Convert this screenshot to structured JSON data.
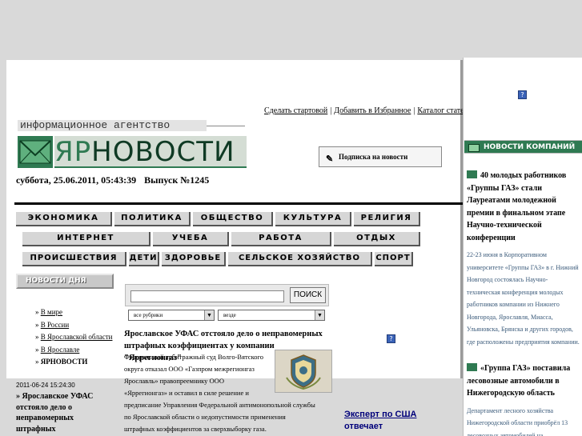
{
  "toplinks": {
    "make_start": "Сделать стартовой",
    "add_fav": "Добавить в Избранное",
    "catalog": "Каталог статей",
    "separator": "|"
  },
  "header": {
    "tagline": "информационное агентство",
    "logo_yar": "ЯР",
    "logo_novosti": "НОВОСТИ",
    "subscribe": "Подписка на новости",
    "date": "суббота, 25.06.2011, 05:43:39",
    "issue": "Выпуск №1245"
  },
  "nav": {
    "row1": [
      "ЭКОНОМИКА",
      "ПОЛИТИКА",
      "ОБЩЕСТВО",
      "КУЛЬТУРА",
      "РЕЛИГИЯ"
    ],
    "row2": [
      "ИНТЕРНЕТ",
      "УЧЕБА",
      "РАБОТА",
      "ОТДЫХ"
    ],
    "row3": [
      "ПРОИСШЕСТВИЯ",
      "ДЕТИ",
      "ЗДОРОВЬЕ",
      "СЕЛЬСКОЕ ХОЗЯЙСТВО",
      "СПОРТ"
    ]
  },
  "news_day": {
    "label": "НОВОСТИ ДНЯ",
    "links": [
      "В мире",
      "В России",
      "В Ярославской области",
      "В Ярославле",
      "ЯРНОВОСТИ"
    ],
    "item_date": "2011-06-24 15:24:30",
    "item_title": "» Ярославское УФАС отстояло дело о неправомерных штрафных"
  },
  "search": {
    "input_value": "",
    "button": "ПОИСК",
    "select_rubric": "все рубрики",
    "select_where": "везде"
  },
  "article": {
    "headline": "Ярославское УФАС отстояло дело о неправомерных штрафных коэффициентах у компании \"Яррегионгаз\"",
    "p1": "Федеральный арбитражный суд Волго-Вятского",
    "p2": "округа отказал ООО «Газпром межрегионгаз",
    "p3": "Ярославль» правопреемнику ООО",
    "p4": "«Яррегионгаз» и оставил в силе решение и",
    "p5": "предписание Управления Федеральной антимонопольной службы",
    "p6": "по Ярославской области о недопустимости применения",
    "p7": "штрафных коэффициентов за сверхвыборку газа."
  },
  "expert": {
    "line1": "Эксперт по США",
    "line2": "отвечает"
  },
  "company_news": {
    "header": "НОВОСТИ КОМПАНИЙ",
    "items": [
      {
        "title": "40 молодых работников «Группы ГАЗ» стали Лауреатами молодежной премии в финальном этапе Научно-технической конференции",
        "desc": "22-23 июня в Корпоративном университете «Группы ГАЗ» в г. Нижний Новгород состоялась Научно-техническая конференция молодых работников компании из Нижнего Новгорода, Ярославля, Миасса, Ульяновска, Брянска и других городов, где расположены предприятия компании."
      },
      {
        "title": "«Группа ГАЗ» поставила лесовозные автомобили в Нижегородскую область",
        "desc": "Департамент лесного хозяйства Нижегородской области приобрёл 13 лесовозных автомобилей на"
      }
    ]
  },
  "help_icon": "?",
  "colors": {
    "brand_green": "#2f7a52",
    "nav_bg": "#d6d6d6",
    "background": "#d9d9d9"
  }
}
